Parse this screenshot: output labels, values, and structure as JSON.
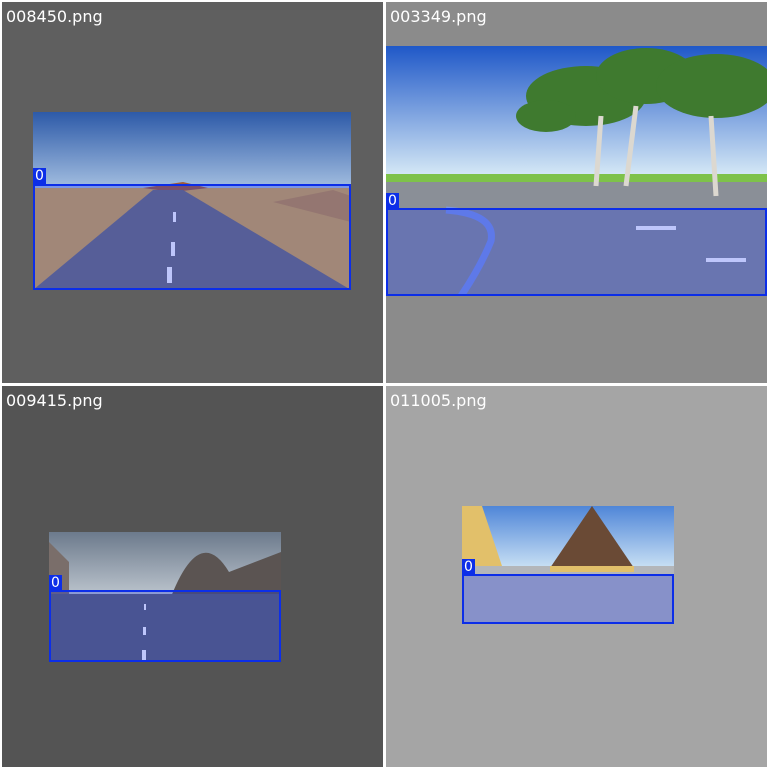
{
  "tiles": [
    {
      "filename": "008450.png",
      "box_label": "0"
    },
    {
      "filename": "003349.png",
      "box_label": "0"
    },
    {
      "filename": "009415.png",
      "box_label": "0"
    },
    {
      "filename": "011005.png",
      "box_label": "0"
    }
  ],
  "colors": {
    "box_stroke": "#0c2ee8",
    "box_fill": "rgba(20,50,240,0.28)",
    "divider": "#ffffff"
  }
}
